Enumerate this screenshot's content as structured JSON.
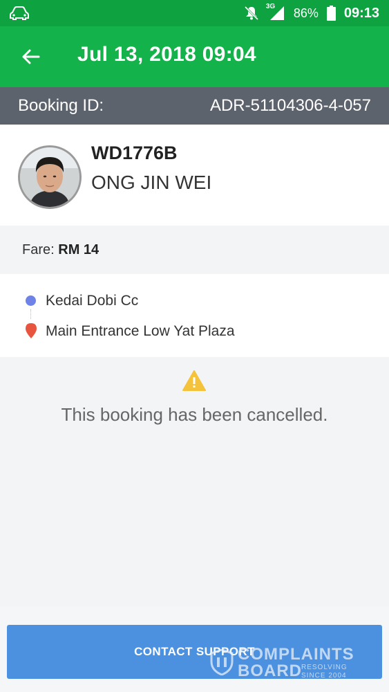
{
  "status_bar": {
    "battery": "86%",
    "network": "3G",
    "time": "09:13",
    "icons": [
      "car-icon",
      "mute-icon",
      "signal-icon",
      "battery-icon"
    ]
  },
  "app_bar": {
    "title": "Jul 13, 2018 09:04",
    "back_icon": "arrow-left-icon"
  },
  "booking": {
    "label": "Booking ID:",
    "id": "ADR-51104306-4-057"
  },
  "driver": {
    "plate": "WD1776B",
    "name": "ONG JIN WEI"
  },
  "fare": {
    "label": "Fare:",
    "amount": "RM 14"
  },
  "route": {
    "pickup": "Kedai Dobi Cc",
    "dropoff": "Main Entrance Low Yat Plaza"
  },
  "cancellation": {
    "message": "This booking has been cancelled."
  },
  "footer": {
    "contact_label": "CONTACT SUPPORT"
  },
  "watermark": {
    "line1": "COMPLAINTS",
    "line2": "BOARD",
    "small1": "RESOLVING",
    "small2": "SINCE 2004"
  },
  "colors": {
    "status_bar": "#0ea340",
    "app_bar": "#13b24a",
    "booking_bar": "#5d636d",
    "button": "#4c90e0",
    "pickup_dot": "#6f82e6",
    "dropoff_pin": "#e8553e",
    "warning": "#f5c33b"
  }
}
